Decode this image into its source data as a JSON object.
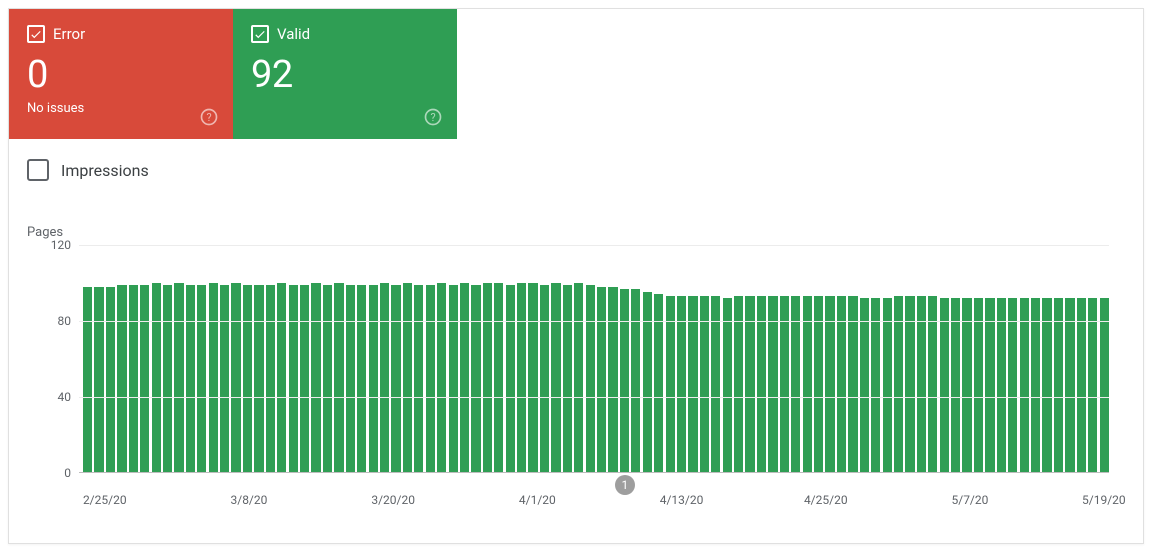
{
  "tiles": {
    "error": {
      "label": "Error",
      "count": "0",
      "sub": "No issues",
      "checked": true
    },
    "valid": {
      "label": "Valid",
      "count": "92",
      "checked": true
    }
  },
  "impressions": {
    "label": "Impressions",
    "checked": false
  },
  "chart_data": {
    "type": "bar",
    "title": "Pages",
    "ylabel": "Pages",
    "ylim": [
      0,
      120
    ],
    "y_ticks": [
      0,
      40,
      80,
      120
    ],
    "x_ticks": [
      "2/25/20",
      "3/8/20",
      "3/20/20",
      "4/1/20",
      "4/13/20",
      "4/25/20",
      "5/7/20",
      "5/19/20"
    ],
    "x_tick_positions": [
      2.5,
      16.5,
      30.5,
      44.5,
      58.5,
      72.5,
      86.5,
      99.5
    ],
    "marker": {
      "label": "1",
      "position_pct": 53
    },
    "categories": [
      "2/24/20",
      "2/25/20",
      "2/26/20",
      "2/27/20",
      "2/28/20",
      "2/29/20",
      "3/1/20",
      "3/2/20",
      "3/3/20",
      "3/4/20",
      "3/5/20",
      "3/6/20",
      "3/7/20",
      "3/8/20",
      "3/9/20",
      "3/10/20",
      "3/11/20",
      "3/12/20",
      "3/13/20",
      "3/14/20",
      "3/15/20",
      "3/16/20",
      "3/17/20",
      "3/18/20",
      "3/19/20",
      "3/20/20",
      "3/21/20",
      "3/22/20",
      "3/23/20",
      "3/24/20",
      "3/25/20",
      "3/26/20",
      "3/27/20",
      "3/28/20",
      "3/29/20",
      "3/30/20",
      "3/31/20",
      "4/1/20",
      "4/2/20",
      "4/3/20",
      "4/4/20",
      "4/5/20",
      "4/6/20",
      "4/7/20",
      "4/8/20",
      "4/9/20",
      "4/10/20",
      "4/11/20",
      "4/12/20",
      "4/13/20",
      "4/14/20",
      "4/15/20",
      "4/16/20",
      "4/17/20",
      "4/18/20",
      "4/19/20",
      "4/20/20",
      "4/21/20",
      "4/22/20",
      "4/23/20",
      "4/24/20",
      "4/25/20",
      "4/26/20",
      "4/27/20",
      "4/28/20",
      "4/29/20",
      "4/30/20",
      "5/1/20",
      "5/2/20",
      "5/3/20",
      "5/4/20",
      "5/5/20",
      "5/6/20",
      "5/7/20",
      "5/8/20",
      "5/9/20",
      "5/10/20",
      "5/11/20",
      "5/12/20",
      "5/13/20",
      "5/14/20",
      "5/15/20",
      "5/16/20",
      "5/17/20",
      "5/18/20",
      "5/19/20",
      "5/20/20",
      "5/21/20",
      "5/22/20",
      "5/23/20"
    ],
    "values": [
      98,
      98,
      98,
      99,
      99,
      99,
      100,
      99,
      100,
      99,
      99,
      100,
      99,
      100,
      99,
      99,
      99,
      100,
      99,
      99,
      100,
      99,
      100,
      99,
      99,
      99,
      100,
      99,
      100,
      99,
      99,
      100,
      99,
      100,
      99,
      100,
      100,
      99,
      100,
      100,
      99,
      100,
      99,
      100,
      99,
      98,
      98,
      97,
      97,
      95,
      94,
      93,
      93,
      93,
      93,
      93,
      92,
      93,
      93,
      93,
      93,
      93,
      93,
      93,
      93,
      93,
      93,
      93,
      92,
      92,
      92,
      93,
      93,
      93,
      93,
      92,
      92,
      92,
      92,
      92,
      92,
      92,
      92,
      92,
      92,
      92,
      92,
      92,
      92,
      92
    ]
  }
}
